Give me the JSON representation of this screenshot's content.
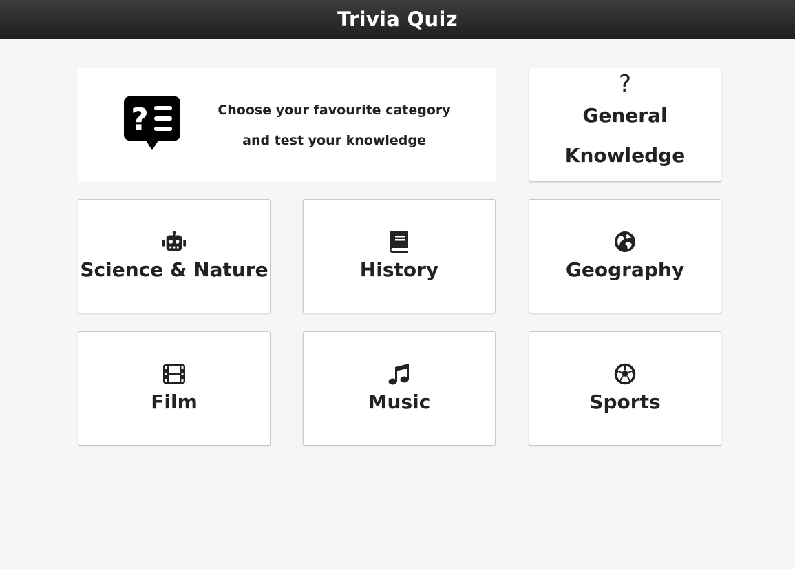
{
  "header": {
    "title": "Trivia Quiz"
  },
  "intro": {
    "icon": "question-list-bubble-icon",
    "line1": "Choose your favourite category",
    "line2": "and test your knowledge"
  },
  "categories": [
    {
      "label": "General Knowledge",
      "icon": "question-mark-icon"
    },
    {
      "label": "Science & Nature",
      "icon": "robot-icon"
    },
    {
      "label": "History",
      "icon": "book-icon"
    },
    {
      "label": "Geography",
      "icon": "globe-icon"
    },
    {
      "label": "Film",
      "icon": "film-icon"
    },
    {
      "label": "Music",
      "icon": "music-note-icon"
    },
    {
      "label": "Sports",
      "icon": "soccer-ball-icon"
    }
  ],
  "colors": {
    "header_bg": "#2b2b2b",
    "page_bg": "#f5f6f8",
    "card_bg": "#ffffff",
    "text": "#222222"
  }
}
